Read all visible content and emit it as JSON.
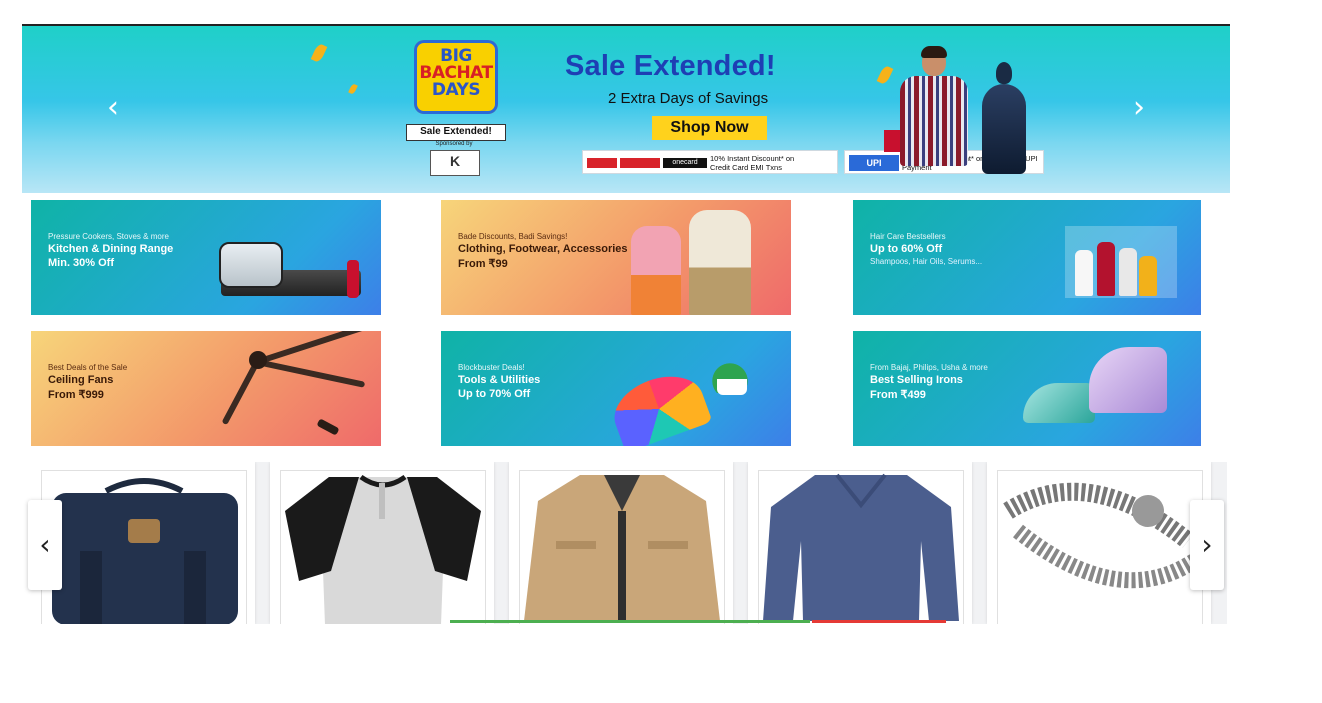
{
  "hero": {
    "logo_line1": "BIG",
    "logo_line2": "BACHAT",
    "logo_line3": "DAYS",
    "logo_tag": "Sale Extended!",
    "sponsored_by": "Sponsored by",
    "sponsor_logo": "K",
    "title": "Sale Extended!",
    "subtitle": "2 Extra Days of Savings",
    "cta": "Shop Now",
    "offer1_text": "10% Instant Discount* on Credit Card EMI Txns",
    "offer1_brand": "onecard",
    "offer2_upi": "UPI",
    "offer2_text": "₹25 Instant Discount* on 1st Flipkart UPI Payment",
    "prev_glyph": "‹",
    "next_glyph": "›"
  },
  "banners": [
    {
      "tag": "Pressure Cookers, Stoves & more",
      "title": "Kitchen & Dining Range",
      "offer": "Min. 30% Off"
    },
    {
      "tag": "Bade Discounts, Badi Savings!",
      "title": "Clothing, Footwear, Accessories",
      "offer": "From ₹99"
    },
    {
      "tag": "Hair Care Bestsellers",
      "title": "Up to 60% Off",
      "offer": "Shampoos, Hair Oils, Serums..."
    },
    {
      "tag": "Best Deals of the Sale",
      "title": "Ceiling Fans",
      "offer": "From ₹999"
    },
    {
      "tag": "Blockbuster Deals!",
      "title": "Tools & Utilities",
      "offer": "Up to 70% Off"
    },
    {
      "tag": "From Bajaj, Philips, Usha & more",
      "title": "Best Selling Irons",
      "offer": "From ₹499"
    }
  ],
  "products": {
    "items": [
      {
        "icon": "backpack-icon"
      },
      {
        "icon": "raglan-tshirt-icon"
      },
      {
        "icon": "jacket-icon"
      },
      {
        "icon": "sweater-icon"
      },
      {
        "icon": "bracelet-icon"
      }
    ],
    "prev_glyph": "‹",
    "next_glyph": "›"
  },
  "colors": {
    "hero_title": "#1e3fb4",
    "cta_bg": "#ffd21c",
    "teal_banner": "#0fb3a6",
    "warm_banner": "#f39a6a"
  }
}
